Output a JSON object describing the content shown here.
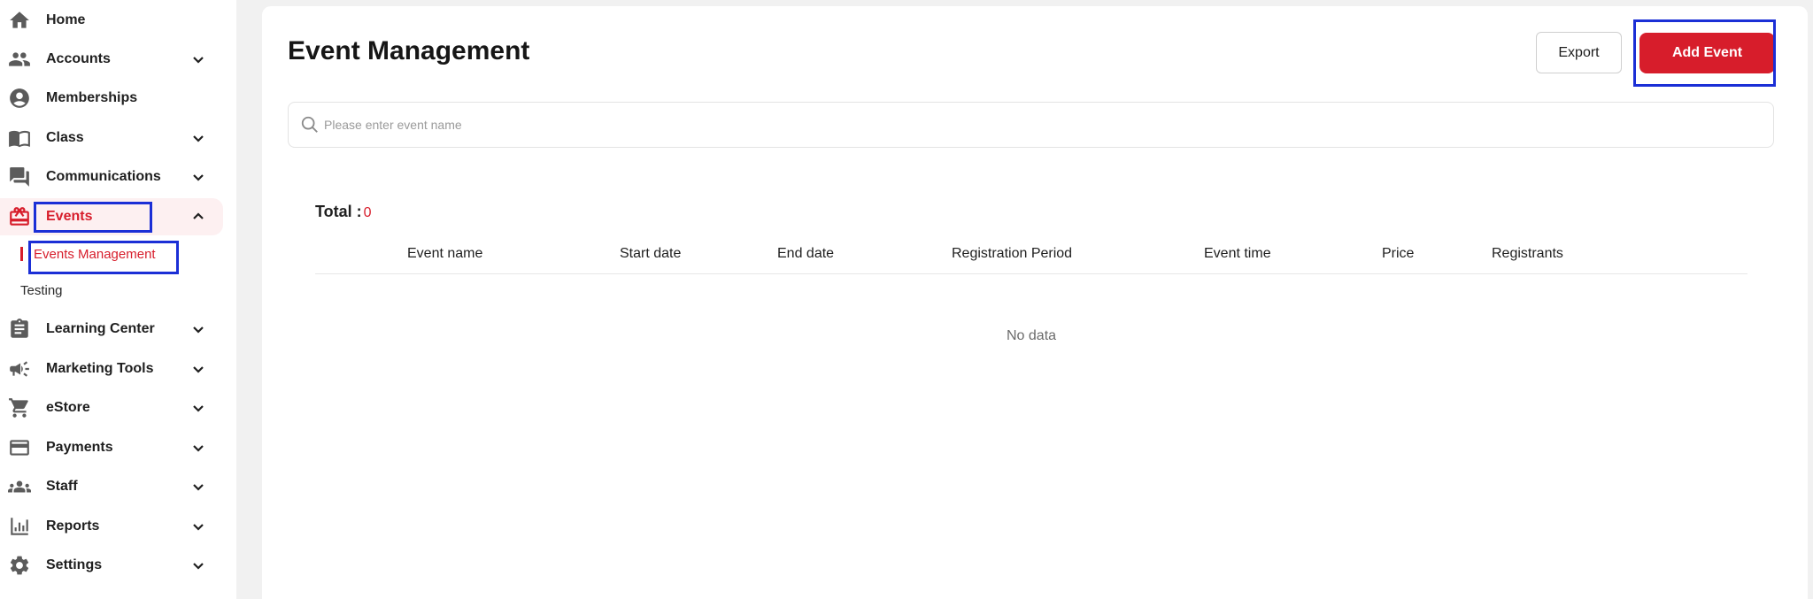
{
  "sidebar": {
    "items": [
      {
        "label": "Home",
        "icon": "home-icon",
        "expandable": false,
        "active": false
      },
      {
        "label": "Accounts",
        "icon": "people-icon",
        "expandable": true,
        "active": false
      },
      {
        "label": "Memberships",
        "icon": "account-circle-icon",
        "expandable": false,
        "active": false
      },
      {
        "label": "Class",
        "icon": "book-icon",
        "expandable": true,
        "active": false
      },
      {
        "label": "Communications",
        "icon": "chat-icon",
        "expandable": true,
        "active": false
      },
      {
        "label": "Events",
        "icon": "gift-icon",
        "expandable": true,
        "active": true
      },
      {
        "label": "Learning Center",
        "icon": "clipboard-icon",
        "expandable": true,
        "active": false
      },
      {
        "label": "Marketing Tools",
        "icon": "megaphone-icon",
        "expandable": true,
        "active": false
      },
      {
        "label": "eStore",
        "icon": "cart-icon",
        "expandable": true,
        "active": false
      },
      {
        "label": "Payments",
        "icon": "credit-card-icon",
        "expandable": true,
        "active": false
      },
      {
        "label": "Staff",
        "icon": "group-icon",
        "expandable": true,
        "active": false
      },
      {
        "label": "Reports",
        "icon": "bar-chart-icon",
        "expandable": true,
        "active": false
      },
      {
        "label": "Settings",
        "icon": "gear-icon",
        "expandable": true,
        "active": false
      }
    ],
    "events_submenu": [
      {
        "label": "Events Management",
        "active": true
      },
      {
        "label": "Testing",
        "active": false
      }
    ]
  },
  "main": {
    "title": "Event Management",
    "export_label": "Export",
    "add_event_label": "Add Event",
    "search_placeholder": "Please enter event name",
    "search_value": "",
    "total_label": "Total :",
    "total_count": "0",
    "table": {
      "columns": [
        "Event name",
        "Start date",
        "End date",
        "Registration Period",
        "Event time",
        "Price",
        "Registrants"
      ],
      "rows": [],
      "empty_text": "No data"
    }
  },
  "colors": {
    "accent": "#d71d2b",
    "active_bg": "#fdf0f1",
    "highlight_box": "#1b2fd6",
    "page_bg": "#f1f1f1"
  }
}
